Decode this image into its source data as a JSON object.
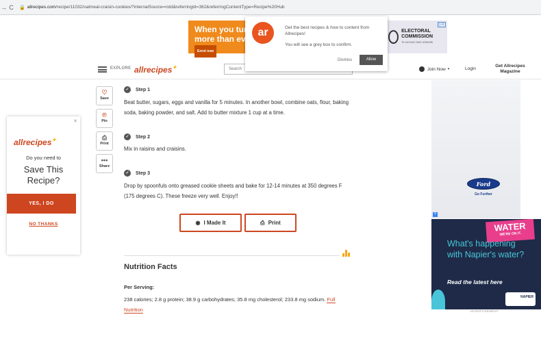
{
  "browser": {
    "url_domain": "allrecipes.com",
    "url_path": "/recipe/11032/oatmeal-craisin-cookies/?internalSource=rotd&referringId=362&referringContentType=Recipe%20Hub"
  },
  "top_ad": {
    "headline": "When you turn more than ever",
    "cta": "Enrol now",
    "sponsor": "ELECTORAL COMMISSION",
    "sponsor_sub": "TE KAITIAKI TAKE KŌWHIRI"
  },
  "notification": {
    "logo_text": "ar",
    "message": "Get the best recipes & how to content from Allrecipes!",
    "message2": "You will see a grey box to confirm.",
    "dismiss": "Dismiss",
    "allow": "Allow"
  },
  "header": {
    "explore": "EXPLORE",
    "brand": "allrecipes",
    "search_placeholder": "Search",
    "join": "Join Now",
    "login": "Login",
    "magazine": "Get Allrecipes Magazine"
  },
  "tools": [
    {
      "label": "Save",
      "icon": "♡"
    },
    {
      "label": "Pin",
      "icon": "℗"
    },
    {
      "label": "Print",
      "icon": "⎙"
    },
    {
      "label": "Share",
      "icon": "•••"
    }
  ],
  "steps": [
    {
      "title": "Step 1",
      "text": "Beat butter, sugars, eggs and vanilla for 5 minutes. In another bowl, combine oats, flour, baking soda, baking powder, and salt. Add to butter mixture 1 cup at a time."
    },
    {
      "title": "Step 2",
      "text": "Mix in raisins and craisins."
    },
    {
      "title": "Step 3",
      "text": "Drop by spoonfuls onto greased cookie sheets and bake for 12-14 minutes at 350 degrees F (175 degrees C). These freeze very well. Enjoy!!"
    }
  ],
  "actions": {
    "made_it": "I Made It",
    "print": "Print"
  },
  "nutrition": {
    "title": "Nutrition Facts",
    "per_serving": "Per Serving:",
    "text": "238 calories; 2.8 g protein; 38.9 g carbohydrates; 35.8 mg cholesterol; 233.8 mg sodium.",
    "link": "Full Nutrition"
  },
  "save_card": {
    "logo": "allrecipes",
    "need": "Do you need to",
    "big": "Save This Recipe?",
    "yes": "YES, I DO",
    "no": "NO THANKS"
  },
  "ford_ad": {
    "logo": "Ford",
    "tagline": "Go Further"
  },
  "water_ad": {
    "badge": "WATER",
    "badge_sub": "WE'RE ON IT.",
    "question": "What's happening with Napier's water?",
    "read": "Read the latest here",
    "brand": "NAPIER",
    "advertisement": "ADVERTISEMENT"
  },
  "colors": {
    "brand": "#ce4620",
    "accent": "#f8b619"
  }
}
